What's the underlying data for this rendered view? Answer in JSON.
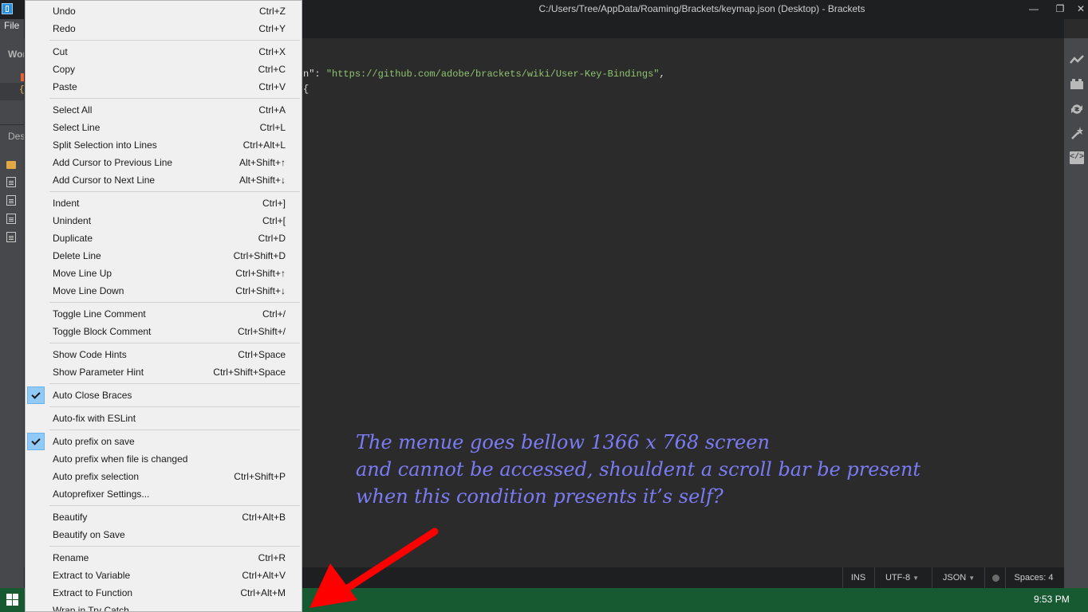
{
  "window": {
    "title": "C:/Users/Tree/AppData/Roaming/Brackets/keymap.json (Desktop) - Brackets",
    "minimize": "—",
    "maximize": "❐",
    "close": "✕"
  },
  "sidebar": {
    "file_menu": "File",
    "working_files_title": "Wor",
    "project_title": "Des",
    "json_icon": "{"
  },
  "editor": {
    "lines": [
      {
        "prefix": "n\": ",
        "string": "\"https://github.com/adobe/brackets/wiki/User-Key-Bindings\"",
        "suffix": ","
      },
      {
        "prefix": "{",
        "string": "",
        "suffix": ""
      }
    ]
  },
  "menu": {
    "items": [
      {
        "label": "Undo",
        "shortcut": "Ctrl+Z",
        "checked": false
      },
      {
        "label": "Redo",
        "shortcut": "Ctrl+Y",
        "checked": false
      },
      {
        "label": "Cut",
        "shortcut": "Ctrl+X",
        "checked": false
      },
      {
        "label": "Copy",
        "shortcut": "Ctrl+C",
        "checked": false
      },
      {
        "label": "Paste",
        "shortcut": "Ctrl+V",
        "checked": false
      },
      {
        "label": "Select All",
        "shortcut": "Ctrl+A",
        "checked": false
      },
      {
        "label": "Select Line",
        "shortcut": "Ctrl+L",
        "checked": false
      },
      {
        "label": "Split Selection into Lines",
        "shortcut": "Ctrl+Alt+L",
        "checked": false
      },
      {
        "label": "Add Cursor to Previous Line",
        "shortcut": "Alt+Shift+↑",
        "checked": false
      },
      {
        "label": "Add Cursor to Next Line",
        "shortcut": "Alt+Shift+↓",
        "checked": false
      },
      {
        "label": "Indent",
        "shortcut": "Ctrl+]",
        "checked": false
      },
      {
        "label": "Unindent",
        "shortcut": "Ctrl+[",
        "checked": false
      },
      {
        "label": "Duplicate",
        "shortcut": "Ctrl+D",
        "checked": false
      },
      {
        "label": "Delete Line",
        "shortcut": "Ctrl+Shift+D",
        "checked": false
      },
      {
        "label": "Move Line Up",
        "shortcut": "Ctrl+Shift+↑",
        "checked": false
      },
      {
        "label": "Move Line Down",
        "shortcut": "Ctrl+Shift+↓",
        "checked": false
      },
      {
        "label": "Toggle Line Comment",
        "shortcut": "Ctrl+/",
        "checked": false
      },
      {
        "label": "Toggle Block Comment",
        "shortcut": "Ctrl+Shift+/",
        "checked": false
      },
      {
        "label": "Show Code Hints",
        "shortcut": "Ctrl+Space",
        "checked": false
      },
      {
        "label": "Show Parameter Hint",
        "shortcut": "Ctrl+Shift+Space",
        "checked": false
      },
      {
        "label": "Auto Close Braces",
        "shortcut": "",
        "checked": true
      },
      {
        "label": "Auto-fix with ESLint",
        "shortcut": "",
        "checked": false
      },
      {
        "label": "Auto prefix on save",
        "shortcut": "",
        "checked": true
      },
      {
        "label": "Auto prefix when file is changed",
        "shortcut": "",
        "checked": false
      },
      {
        "label": "Auto prefix selection",
        "shortcut": "Ctrl+Shift+P",
        "checked": false
      },
      {
        "label": "Autoprefixer Settings...",
        "shortcut": "",
        "checked": false
      },
      {
        "label": "Beautify",
        "shortcut": "Ctrl+Alt+B",
        "checked": false
      },
      {
        "label": "Beautify on Save",
        "shortcut": "",
        "checked": false
      },
      {
        "label": "Rename",
        "shortcut": "Ctrl+R",
        "checked": false
      },
      {
        "label": "Extract to Variable",
        "shortcut": "Ctrl+Alt+V",
        "checked": false
      },
      {
        "label": "Extract to Function",
        "shortcut": "Ctrl+Alt+M",
        "checked": false
      },
      {
        "label": "Wrap in Try Catch",
        "shortcut": "",
        "checked": false
      }
    ]
  },
  "statusbar": {
    "ins": "INS",
    "encoding": "UTF-8",
    "language": "JSON",
    "spaces": "Spaces: 4"
  },
  "taskbar": {
    "clock": "9:53 PM"
  },
  "annotation": {
    "lines": [
      "The menue goes bellow 1366 x 768 screen",
      "and cannot be accessed, shouldent a scroll bar be present",
      "when this condition presents it’s self?"
    ]
  },
  "colors": {
    "annotation": "#7b7cf5",
    "arrow": "#ff0000",
    "taskbar": "#175930",
    "check_highlight": "#91c9f7"
  }
}
